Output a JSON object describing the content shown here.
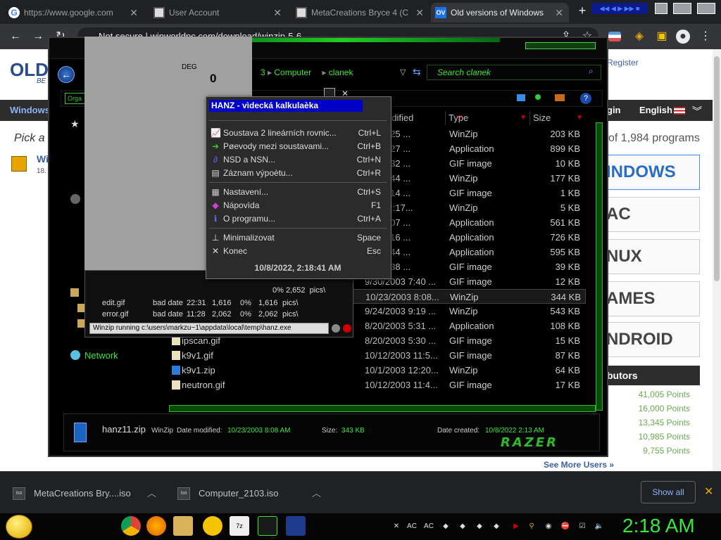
{
  "browser": {
    "tabs": [
      {
        "title": "https://www.google.com",
        "icon": "google-icon"
      },
      {
        "title": "User Account",
        "icon": "page-icon"
      },
      {
        "title": "MetaCreations Bryce 4 (C",
        "icon": "page-icon"
      },
      {
        "title": "Old versions of Windows",
        "icon": "ov-icon"
      }
    ],
    "address": "Not secure | winworldpc.com/download/winzip-5-6"
  },
  "site": {
    "logo": "OLD",
    "logo_sub": "BE",
    "register": "Register",
    "nav_windows": "Windows",
    "nav_login": "gin",
    "nav_lang": "English",
    "pick": "Pick a",
    "item_title": "Wi",
    "item_sub": "18.",
    "programs_count": "of 1,984 programs",
    "os_buttons": [
      "INDOWS",
      "AC",
      "NUX",
      "AMES",
      "NDROID"
    ],
    "contributors_header": "butors",
    "points": [
      "41,005 Points",
      "16,000 Points",
      "13,345 Points",
      "10,985 Points",
      "9,755 Points"
    ],
    "see_more": "See More Users »"
  },
  "explorer": {
    "breadcrumb": [
      "3",
      "Computer",
      "clanek"
    ],
    "search_placeholder": "Search clanek",
    "organize": "Orga",
    "columns": {
      "modified": "odified",
      "type": "Type",
      "size": "Size"
    },
    "rows": [
      {
        "name": "",
        "date": "003 8:25 ...",
        "type": "WinZip",
        "size": "203 KB",
        "icon": "zip"
      },
      {
        "name": "",
        "date": "003 9:27 ...",
        "type": "Application",
        "size": "899 KB",
        "icon": "file"
      },
      {
        "name": "",
        "date": "003 9:32 ...",
        "type": "GIF image",
        "size": "10 KB",
        "icon": "file"
      },
      {
        "name": "",
        "date": "003 4:44 ...",
        "type": "WinZip",
        "size": "177 KB",
        "icon": "zip"
      },
      {
        "name": "",
        "date": "003 8:14 ...",
        "type": "GIF image",
        "size": "1 KB",
        "icon": "file"
      },
      {
        "name": "",
        "date": "003 12:17...",
        "type": "WinZip",
        "size": "5 KB",
        "icon": "zip"
      },
      {
        "name": "",
        "date": "003 6:07 ...",
        "type": "Application",
        "size": "561 KB",
        "icon": "file"
      },
      {
        "name": "",
        "date": "003 8:16 ...",
        "type": "Application",
        "size": "726 KB",
        "icon": "file"
      },
      {
        "name": "",
        "date": "003 8:44 ...",
        "type": "Application",
        "size": "595 KB",
        "icon": "file"
      },
      {
        "name": "",
        "date": "003 8:38 ...",
        "type": "GIF image",
        "size": "39 KB",
        "icon": "file"
      },
      {
        "name": "",
        "date": "9/30/2003 7:40 ...",
        "type": "GIF image",
        "size": "12 KB",
        "icon": "file"
      },
      {
        "name": "",
        "date": "10/23/2003 8:08...",
        "type": "WinZip",
        "size": "344 KB",
        "icon": "zip"
      },
      {
        "name": "",
        "date": "9/24/2003 9:19 ...",
        "type": "WinZip",
        "size": "543 KB",
        "icon": "zip"
      },
      {
        "name": "",
        "date": "8/20/2003 5:31 ...",
        "type": "Application",
        "size": "108 KB",
        "icon": "file"
      },
      {
        "name": "ipscan.gif",
        "date": "8/20/2003 5:30 ...",
        "type": "GIF image",
        "size": "15 KB",
        "icon": "file"
      },
      {
        "name": "k9v1.gif",
        "date": "10/12/2003 11:5...",
        "type": "GIF image",
        "size": "87 KB",
        "icon": "file"
      },
      {
        "name": "k9v1.zip",
        "date": "10/1/2003 12:20...",
        "type": "WinZip",
        "size": "64 KB",
        "icon": "zip"
      },
      {
        "name": "neutron.gif",
        "date": "10/12/2003 11:4...",
        "type": "GIF image",
        "size": "17 KB",
        "icon": "file"
      }
    ],
    "network": "Network",
    "details": {
      "name": "hanz11.zip",
      "type": "WinZip",
      "modified_label": "Date modified:",
      "modified": "10/23/2003 8:08 AM",
      "size_label": "Size:",
      "size": "343 KB",
      "created_label": "Date created:",
      "created": "10/8/2022 2:13 AM",
      "brand": "RAZER"
    }
  },
  "calc": {
    "deg": "DEG",
    "display": "0"
  },
  "winzip": {
    "rows": [
      {
        "name": "edit.gif",
        "type": "bad date",
        "time": "22:31",
        "a": "1,616",
        "b": "0%",
        "c": "1,616",
        "d": "pics\\"
      },
      {
        "name": "error.gif",
        "type": "bad date",
        "time": "11:28",
        "a": "2,062",
        "b": "0%",
        "c": "2,062",
        "d": "pics\\"
      }
    ],
    "partial_row": {
      "c": "2,652",
      "d": "pics\\",
      "b": "0%"
    },
    "status": "Winzip running c:\\users\\markzu~1\\appdata\\local\\temp\\hanz.exe"
  },
  "menu": {
    "title": "HANZ - vìdecká kalkulaèka",
    "items": [
      {
        "label": "Soustava 2 lineárních rovnic...",
        "shortcut": "Ctrl+L",
        "icon": "graph-icon"
      },
      {
        "label": "Pøevody mezi soustavami...",
        "shortcut": "Ctrl+B",
        "icon": "arrow-icon"
      },
      {
        "label": "NSD a NSN...",
        "shortcut": "Ctrl+N",
        "icon": "math-icon"
      },
      {
        "label": "Záznam výpoètu...",
        "shortcut": "Ctrl+R",
        "icon": "record-icon"
      },
      {
        "label": "Nastavení...",
        "shortcut": "Ctrl+S",
        "icon": "settings-icon"
      },
      {
        "label": "Nápovìda",
        "shortcut": "F1",
        "icon": "help-book-icon"
      },
      {
        "label": "O programu...",
        "shortcut": "Ctrl+A",
        "icon": "info-icon"
      },
      {
        "label": "Minimalizovat",
        "shortcut": "Space",
        "icon": "minimize-icon"
      },
      {
        "label": "Konec",
        "shortcut": "Esc",
        "icon": "close-icon"
      }
    ],
    "timestamp": "10/8/2022, 2:18:41 AM"
  },
  "downloads": {
    "items": [
      "MetaCreations Bry....iso",
      "Computer_2103.iso"
    ],
    "show_all": "Show all"
  },
  "taskbar": {
    "clock": "2:18 AM"
  }
}
